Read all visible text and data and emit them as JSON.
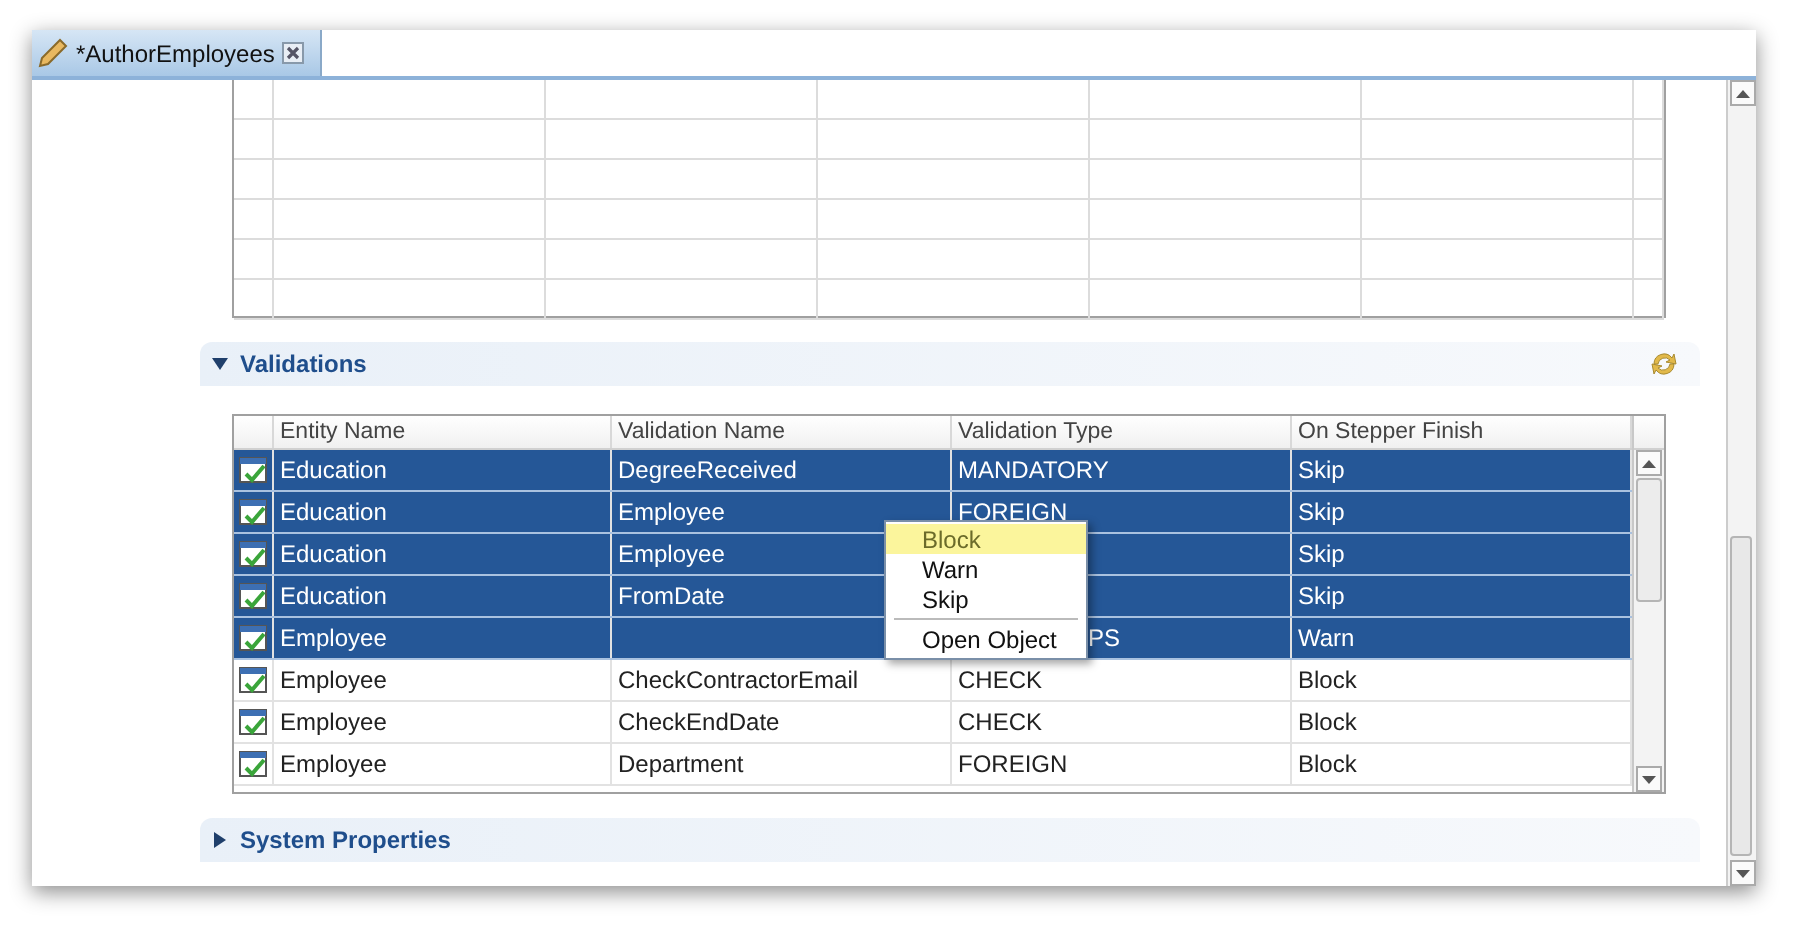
{
  "editor_tab": {
    "title": "*AuthorEmployees",
    "dirty": true
  },
  "validations": {
    "title": "Validations",
    "expanded": true,
    "columns": [
      "Entity Name",
      "Validation Name",
      "Validation Type",
      "On Stepper Finish"
    ],
    "rows": [
      {
        "selected": true,
        "entity": "Education",
        "name": "DegreeReceived",
        "type": "MANDATORY",
        "finish": "Skip"
      },
      {
        "selected": true,
        "entity": "Education",
        "name": "Employee",
        "type": "FOREIGN",
        "finish": "Skip"
      },
      {
        "selected": true,
        "entity": "Education",
        "name": "Employee",
        "finish": "Skip"
      },
      {
        "selected": true,
        "entity": "Education",
        "name": "FromDate",
        "finish": "Skip"
      },
      {
        "selected": true,
        "entity": "Employee",
        "type": "PS",
        "type_covered": true,
        "finish": "Warn"
      },
      {
        "selected": false,
        "entity": "Employee",
        "name": "CheckContractorEmail",
        "type": "CHECK",
        "finish": "Block"
      },
      {
        "selected": false,
        "entity": "Employee",
        "name": "CheckEndDate",
        "type": "CHECK",
        "finish": "Block"
      },
      {
        "selected": false,
        "entity": "Employee",
        "name": "Department",
        "type": "FOREIGN",
        "finish": "Block"
      }
    ]
  },
  "context_menu": {
    "items": [
      {
        "kind": "item",
        "label": "Block",
        "selected": true
      },
      {
        "kind": "item",
        "label": "Warn",
        "selected": false
      },
      {
        "kind": "item",
        "label": "Skip",
        "selected": false
      },
      {
        "kind": "separator"
      },
      {
        "kind": "item",
        "label": "Open Object",
        "selected": false
      }
    ]
  },
  "system_properties": {
    "title": "System Properties",
    "expanded": false
  }
}
